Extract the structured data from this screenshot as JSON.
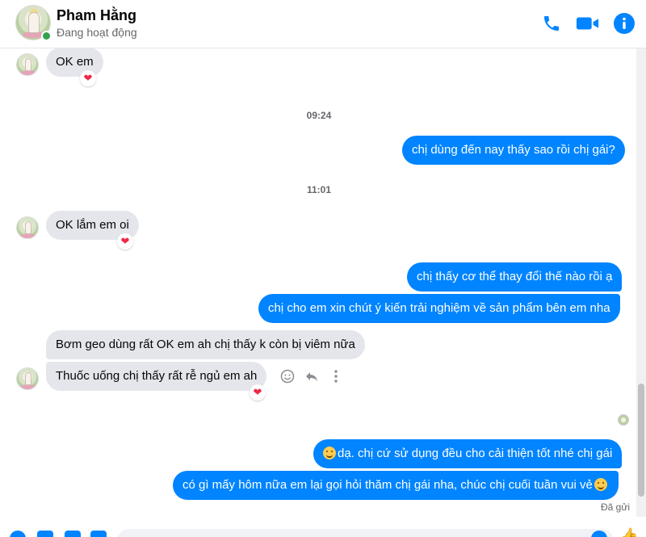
{
  "header": {
    "name": "Pham Hằng",
    "status": "Đang hoạt động"
  },
  "messages": [
    {
      "text": "OK em",
      "reaction": "❤"
    },
    {
      "time": "09:24"
    },
    {
      "text": "chị dùng đến nay thấy sao rồi chị gái?"
    },
    {
      "time": "11:01"
    },
    {
      "text": "OK lắm em oi",
      "reaction": "❤"
    },
    {
      "text": "chị thấy cơ thể thay đổi thế nào rồi ạ"
    },
    {
      "text": "chị cho em xin chút ý kiến trải nghiệm về sản phẩm bên em nha"
    },
    {
      "text": "Bơm geo dùng rất OK em ah chị thấy k còn bị viêm nữa"
    },
    {
      "text": "Thuốc uống chị thấy rất rễ ngủ em ah",
      "reaction": "❤"
    },
    {
      "text": "dạ. chị cứ sử dụng đều cho cải thiện tốt nhé chị gái"
    },
    {
      "text": "có gì mấy hôm nữa em lại gọi hỏi thăm chị gái nha, chúc chị cuối tuần vui vẻ"
    }
  ],
  "sent_label": "Đã gửi",
  "colors": {
    "accent": "#0084ff",
    "incoming_bubble": "#e4e6eb",
    "online": "#31a24c",
    "heart": "#f02849"
  },
  "icons": [
    "phone-icon",
    "video-icon",
    "info-icon",
    "smile-icon",
    "reply-icon",
    "more-icon",
    "emoji-icon"
  ]
}
